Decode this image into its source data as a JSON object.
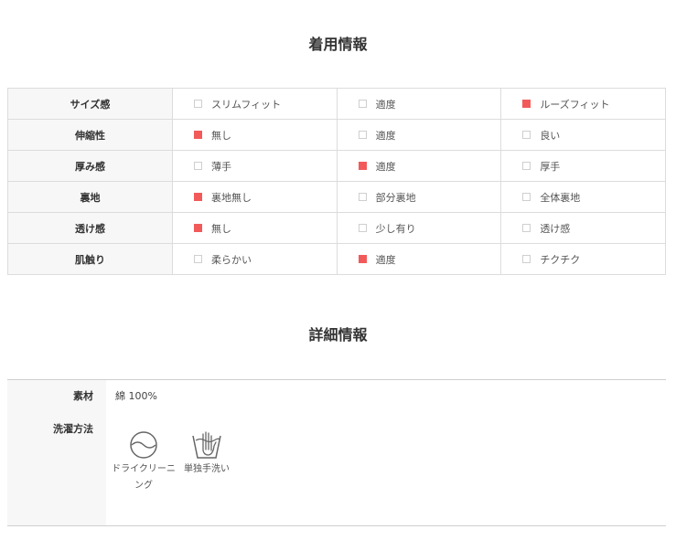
{
  "fit_section": {
    "title": "着用情報",
    "rows": [
      {
        "label": "サイズ感",
        "options": [
          {
            "text": "スリムフィット",
            "checked": false
          },
          {
            "text": "適度",
            "checked": false
          },
          {
            "text": "ルーズフィット",
            "checked": true
          }
        ]
      },
      {
        "label": "伸縮性",
        "options": [
          {
            "text": "無し",
            "checked": true
          },
          {
            "text": "適度",
            "checked": false
          },
          {
            "text": "良い",
            "checked": false
          }
        ]
      },
      {
        "label": "厚み感",
        "options": [
          {
            "text": "薄手",
            "checked": false
          },
          {
            "text": "適度",
            "checked": true
          },
          {
            "text": "厚手",
            "checked": false
          }
        ]
      },
      {
        "label": "裏地",
        "options": [
          {
            "text": "裏地無し",
            "checked": true
          },
          {
            "text": "部分裏地",
            "checked": false
          },
          {
            "text": "全体裏地",
            "checked": false
          }
        ]
      },
      {
        "label": "透け感",
        "options": [
          {
            "text": "無し",
            "checked": true
          },
          {
            "text": "少し有り",
            "checked": false
          },
          {
            "text": "透け感",
            "checked": false
          }
        ]
      },
      {
        "label": "肌触り",
        "options": [
          {
            "text": "柔らかい",
            "checked": false
          },
          {
            "text": "適度",
            "checked": true
          },
          {
            "text": "チクチク",
            "checked": false
          }
        ]
      }
    ]
  },
  "detail_section": {
    "title": "詳細情報",
    "material_label": "素材",
    "material_value": "綿 100%",
    "wash_label": "洗濯方法",
    "wash_items": [
      {
        "icon": "dry-cleaning-icon",
        "text_line1": "ドライクリーニ",
        "text_line2": "ング"
      },
      {
        "icon": "hand-wash-icon",
        "text_line1": "単独手洗い",
        "text_line2": ""
      }
    ]
  },
  "colors": {
    "checked": "#f25a5a",
    "unchecked_border": "#cfcfcf",
    "label_bg": "#f7f7f7"
  }
}
